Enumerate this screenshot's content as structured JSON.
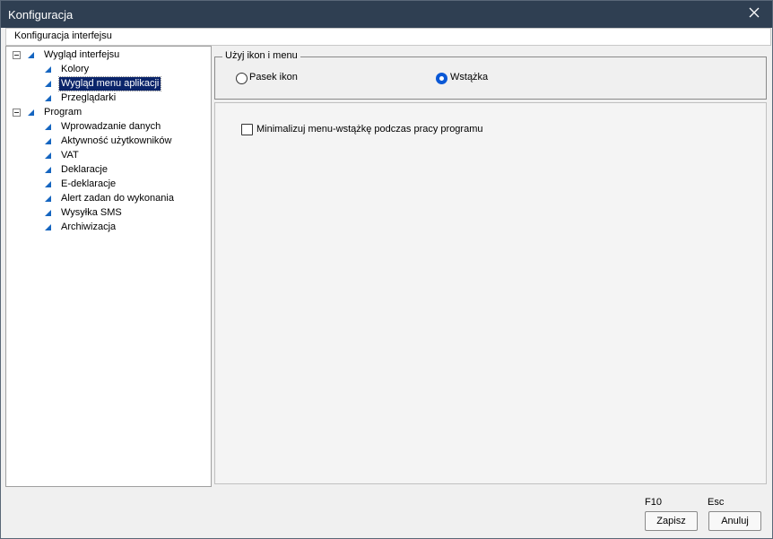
{
  "window": {
    "title": "Konfiguracja"
  },
  "header": {
    "label": "Konfiguracja interfejsu"
  },
  "tree": {
    "group1": {
      "label": "Wygląd interfejsu"
    },
    "kolory": "Kolory",
    "wyglad_menu": "Wygląd menu aplikacji",
    "przegladarki": "Przeglądarki",
    "group2": {
      "label": "Program"
    },
    "wprowadzanie": "Wprowadzanie danych",
    "aktywnosc": "Aktywność użytkowników",
    "vat": "VAT",
    "deklaracje": "Deklaracje",
    "edeklaracje": "E-deklaracje",
    "alert": "Alert zadan do wykonania",
    "sms": "Wysyłka SMS",
    "archiwizacja": "Archiwizacja",
    "selected": "Wygląd menu aplikacji"
  },
  "menu_mode": {
    "title": "Użyj ikon i menu",
    "option_icons": "Pasek ikon",
    "option_ribbon": "Wstążka",
    "selected": "Wstążka"
  },
  "options": {
    "minimize_ribbon_label": "Minimalizuj menu-wstążkę podczas pracy programu",
    "minimize_ribbon_checked": false
  },
  "footer": {
    "save_key": "F10",
    "cancel_key": "Esc",
    "save_label": "Zapisz",
    "cancel_label": "Anuluj"
  },
  "colors": {
    "titlebar": "#2f3f52",
    "selection": "#0a246a",
    "tree_icon": "#1565c0",
    "radio_checked": "#0a58d6"
  }
}
